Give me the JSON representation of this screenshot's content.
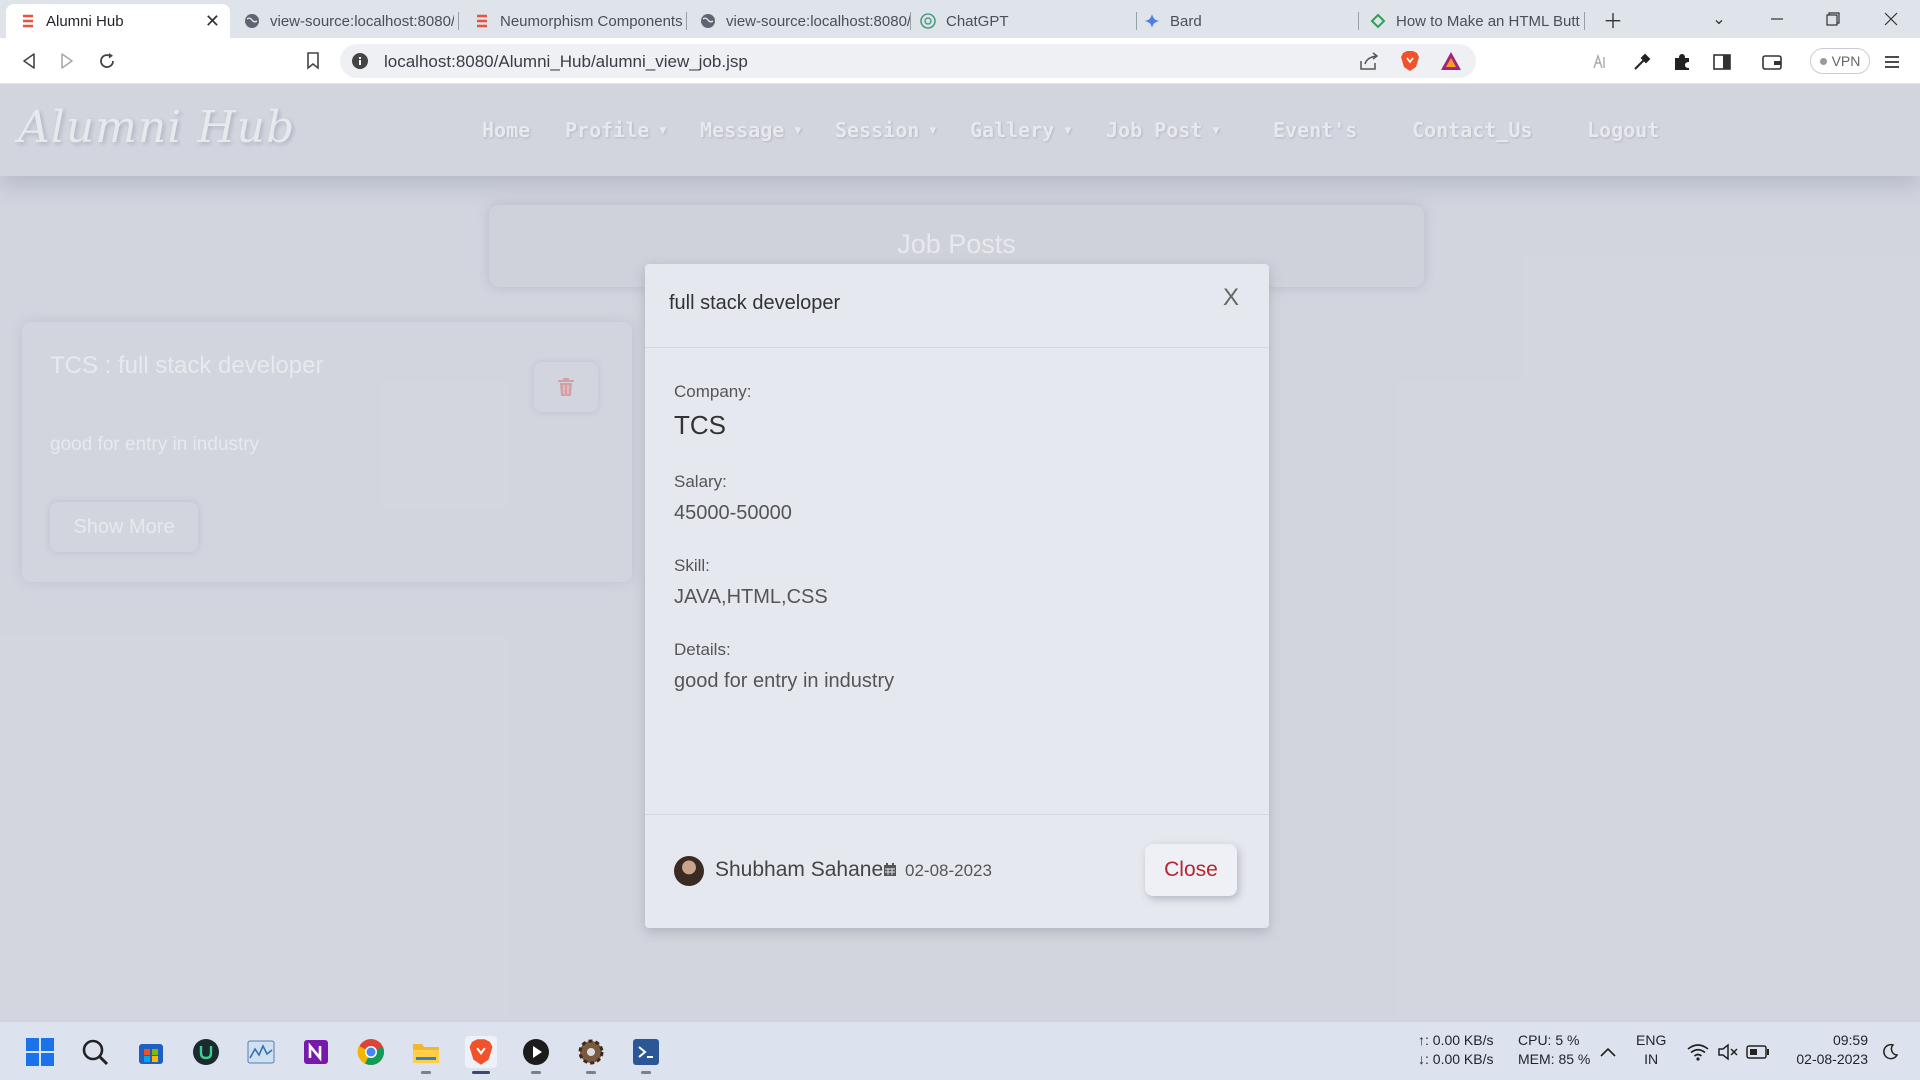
{
  "browser": {
    "tabs": [
      {
        "label": "Alumni Hub",
        "icon": "neumorphism-favicon",
        "active": true
      },
      {
        "label": "view-source:localhost:8080/",
        "icon": "globe-icon"
      },
      {
        "label": "Neumorphism Components",
        "icon": "neumorphism-favicon"
      },
      {
        "label": "view-source:localhost:8080/",
        "icon": "globe-icon"
      },
      {
        "label": "ChatGPT",
        "icon": "chatgpt-icon"
      },
      {
        "label": "Bard",
        "icon": "bard-sparkle-icon"
      },
      {
        "label": "How to Make an HTML Button",
        "icon": "site-favicon"
      }
    ],
    "url": "localhost:8080/Alumni_Hub/alumni_view_job.jsp",
    "vpn_label": "VPN"
  },
  "site": {
    "brand": "Alumni Hub",
    "nav": [
      {
        "label": "Home",
        "dropdown": false
      },
      {
        "label": "Profile",
        "dropdown": true
      },
      {
        "label": "Message",
        "dropdown": true
      },
      {
        "label": "Session",
        "dropdown": true
      },
      {
        "label": "Gallery",
        "dropdown": true
      },
      {
        "label": "Job Post",
        "dropdown": true
      },
      {
        "label": "Event's",
        "dropdown": false
      },
      {
        "label": "Contact_Us",
        "dropdown": false
      },
      {
        "label": "Logout",
        "dropdown": false
      }
    ],
    "section_title": "Job Posts"
  },
  "job_card": {
    "title": "TCS : full stack developer",
    "description": "good for entry in industry",
    "show_more": "Show More"
  },
  "modal": {
    "title": "full stack developer",
    "close_x": "X",
    "company_label": "Company:",
    "company": "TCS",
    "salary_label": "Salary:",
    "salary": "45000-50000",
    "skill_label": "Skill:",
    "skill": "JAVA,HTML,CSS",
    "details_label": "Details:",
    "details": "good for entry in industry",
    "author": "Shubham Sahane",
    "date": "02-08-2023",
    "close_button": "Close"
  },
  "taskbar": {
    "apps": [
      "windows-start-icon",
      "search-icon",
      "store-icon",
      "upwork-icon",
      "monitor-app-icon",
      "onenote-icon",
      "chrome-icon",
      "file-explorer-icon",
      "brave-icon",
      "media-player-icon",
      "settings-gear-app-icon",
      "code-app-icon"
    ],
    "net_up": "↑: 0.00 KB/s",
    "net_down": "↓: 0.00 KB/s",
    "cpu": "CPU: 5 %",
    "mem": "MEM: 85 %",
    "lang": "ENG",
    "region": "IN",
    "time": "09:59",
    "date": "02-08-2023"
  },
  "colors": {
    "page_bg": "#e4e6ee",
    "close_text": "#b4272f",
    "taskbar_bg": "#dde3ee"
  }
}
